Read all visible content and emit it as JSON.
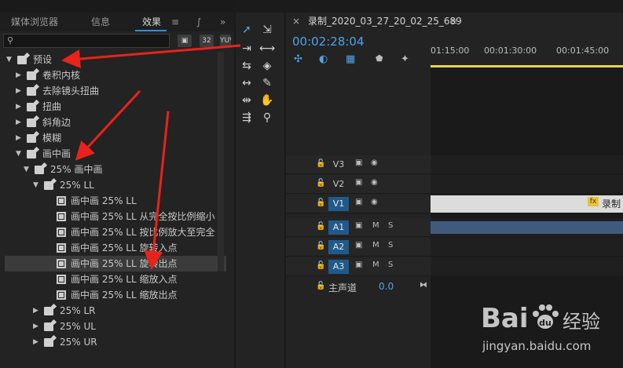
{
  "effects_panel": {
    "tabs": [
      "媒体浏览器",
      "信息",
      "效果",
      "≡",
      "∫",
      "»"
    ],
    "active_tab": "效果",
    "search_placeholder": "",
    "toolbar_buttons": [
      "▣",
      "32",
      "YUV"
    ],
    "tree": [
      {
        "label": "预设",
        "level": 0,
        "expanded": true,
        "type": "folder"
      },
      {
        "label": "卷积内核",
        "level": 1,
        "expanded": false,
        "type": "folder"
      },
      {
        "label": "去除镜头扭曲",
        "level": 1,
        "expanded": false,
        "type": "folder"
      },
      {
        "label": "扭曲",
        "level": 1,
        "expanded": false,
        "type": "folder"
      },
      {
        "label": "斜角边",
        "level": 1,
        "expanded": false,
        "type": "folder"
      },
      {
        "label": "模糊",
        "level": 1,
        "expanded": false,
        "type": "folder"
      },
      {
        "label": "画中画",
        "level": 1,
        "expanded": true,
        "type": "folder"
      },
      {
        "label": "25% 画中画",
        "level": 2,
        "expanded": true,
        "type": "folder"
      },
      {
        "label": "25% LL",
        "level": 3,
        "expanded": true,
        "type": "folder"
      },
      {
        "label": "画中画 25% LL",
        "level": 4,
        "type": "preset"
      },
      {
        "label": "画中画 25% LL 从完全按比例缩小",
        "level": 4,
        "type": "preset"
      },
      {
        "label": "画中画 25% LL 按比例放大至完全",
        "level": 4,
        "type": "preset"
      },
      {
        "label": "画中画 25% LL 旋转入点",
        "level": 4,
        "type": "preset"
      },
      {
        "label": "画中画 25% LL 旋转出点",
        "level": 4,
        "type": "preset",
        "selected": true
      },
      {
        "label": "画中画 25% LL 缩放入点",
        "level": 4,
        "type": "preset"
      },
      {
        "label": "画中画 25% LL 缩放出点",
        "level": 4,
        "type": "preset"
      },
      {
        "label": "25% LR",
        "level": 3,
        "expanded": false,
        "type": "folder"
      },
      {
        "label": "25% UL",
        "level": 3,
        "expanded": false,
        "type": "folder"
      },
      {
        "label": "25% UR",
        "level": 3,
        "expanded": false,
        "type": "folder"
      }
    ]
  },
  "tools_panel": {
    "tools": [
      "selection-tool",
      "track-select-tool",
      "ripple-edit-tool",
      "razor-tool",
      "slip-tool",
      "pen-tool",
      "hand-tool",
      "zoom-tool"
    ]
  },
  "timeline": {
    "sequence_name": "录制_2020_03_27_20_02_25_689",
    "menu_glyph": "≡",
    "close_glyph": "×",
    "timecode": "00:02:28:04",
    "ruler_ticks": [
      "01:15:00",
      "00:01:30:00",
      "00:01:45:00"
    ],
    "tracks": [
      {
        "name": "V3",
        "kind": "video",
        "targeted": false
      },
      {
        "name": "V2",
        "kind": "video",
        "targeted": false
      },
      {
        "name": "V1",
        "kind": "video",
        "targeted": true
      },
      {
        "name": "A1",
        "kind": "audio",
        "targeted": true
      },
      {
        "name": "A2",
        "kind": "audio",
        "targeted": true
      },
      {
        "name": "A3",
        "kind": "audio",
        "targeted": true
      }
    ],
    "master_track": {
      "label": "主声道",
      "value": "0.0"
    },
    "audio_buttons": [
      "M",
      "S"
    ],
    "clip_label": "录制_",
    "fx_badge": "fx"
  },
  "watermark": {
    "brand": "Bai",
    "brand_suffix": "du",
    "cn": "经验",
    "url": "jingyan.baidu.com"
  },
  "colors": {
    "accent": "#2d8ceb",
    "timecode": "#4fa3e9",
    "playhead_bar": "#e8d44d",
    "arrow": "#e8231b",
    "track_target": "#1f5a8a"
  }
}
